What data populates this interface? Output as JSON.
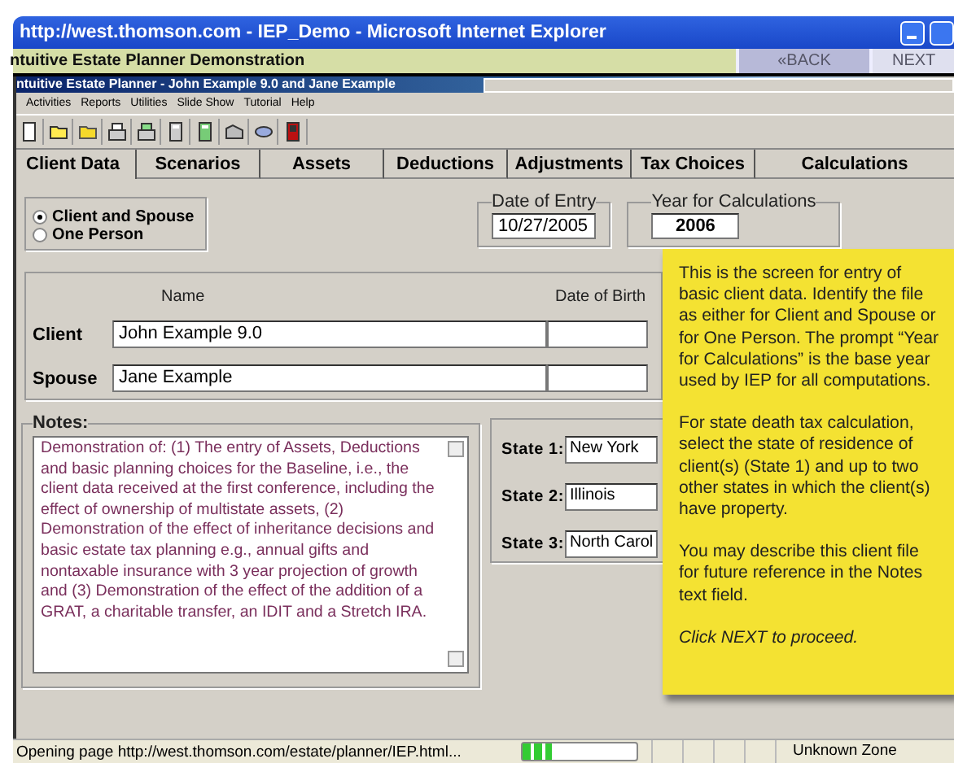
{
  "browser_window": {
    "title": "http://west.thomson.com - IEP_Demo - Microsoft Internet Explorer"
  },
  "demo_bar": {
    "title": "ntuitive Estate Planner Demonstration",
    "buttons": [
      {
        "label": "«BACK",
        "kind": "back"
      },
      {
        "label": "NEXT",
        "kind": "next"
      }
    ]
  },
  "app_window": {
    "title": "ntuitive Estate Planner - John Example 9.0 and Jane Example"
  },
  "menu": [
    "Activities",
    "Reports",
    "Utilities",
    "Slide Show",
    "Tutorial",
    "Help"
  ],
  "tabs": [
    {
      "label": "Client Data",
      "selected": true
    },
    {
      "label": "Scenarios",
      "selected": false
    },
    {
      "label": "Assets",
      "selected": false
    },
    {
      "label": "Deductions",
      "selected": false
    },
    {
      "label": "Adjustments",
      "selected": false
    },
    {
      "label": "Tax Choices",
      "selected": false
    },
    {
      "label": "Calculations",
      "selected": false
    }
  ],
  "file_type": [
    {
      "label": "Client and Spouse",
      "selected": true
    },
    {
      "label": "One Person",
      "selected": false
    }
  ],
  "date_of_entry": {
    "label": "Date of Entry",
    "value": "10/27/2005"
  },
  "year_for_calculations": {
    "label": "Year for Calculations",
    "value": "2006"
  },
  "people": {
    "columns": [
      "Name",
      "Date of Birth"
    ],
    "rows": [
      {
        "label": "Client",
        "name": "John Example 9.0"
      },
      {
        "label": "Spouse",
        "name": "Jane Example"
      }
    ]
  },
  "notes": {
    "label": "Notes:",
    "value": "Demonstration of:  (1) The entry of Assets, Deductions and basic planning choices for the Baseline, i.e., the client data received at the first conference, including the effect of ownership of multistate assets, (2) Demonstration of the effect of inheritance decisions and basic estate tax planning e.g., annual gifts and nontaxable insurance with 3 year projection of growth and (3) Demonstration of the effect of the addition of a GRAT, a charitable transfer, an IDIT and a Stretch IRA."
  },
  "states": [
    {
      "label": "State 1:",
      "value": "New York"
    },
    {
      "label": "State 2:",
      "value": "Illinois"
    },
    {
      "label": "State 3:",
      "value": "North Carol"
    }
  ],
  "callout": {
    "paragraphs": [
      {
        "kind": "plain",
        "text": "This is the screen for entry of basic client data.  Identify the file as either for Client and Spouse or for One Person.  The prompt “Year for Calculations” is the base year used by IEP for all computations."
      },
      {
        "kind": "plain",
        "text": "For state death tax calculation, select the state of residence of client(s) (State 1) and up to two other states in which the client(s) have property."
      },
      {
        "kind": "plain",
        "text": "You may describe this client file for future reference in the Notes text field."
      },
      {
        "kind": "italic",
        "text": "Click NEXT to proceed."
      }
    ]
  },
  "status_bar": {
    "text": "Opening page http://west.thomson.com/estate/planner/IEP.html...",
    "progress": {
      "level": 0.25
    },
    "zone": "Unknown Zone"
  }
}
